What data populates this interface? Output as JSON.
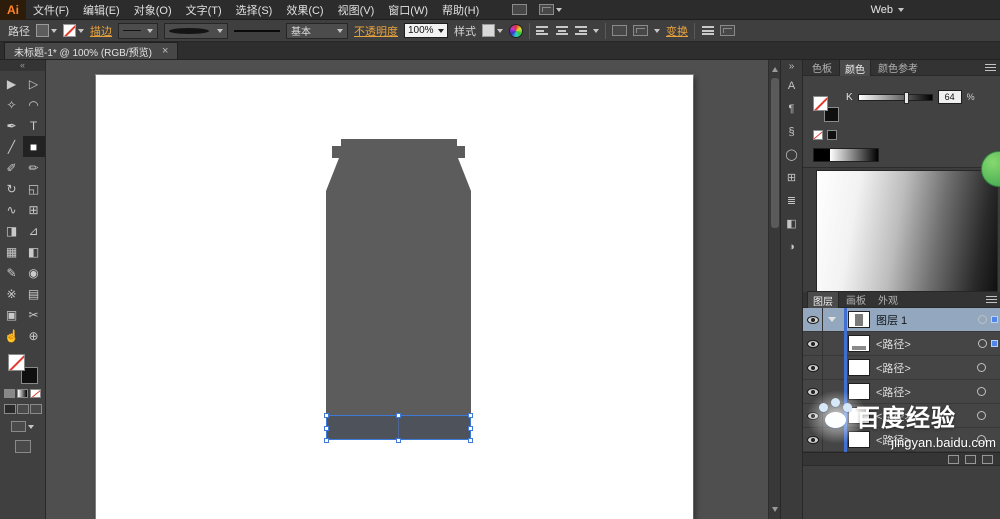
{
  "menu_bar": {
    "logo": "Ai",
    "items": [
      "文件(F)",
      "编辑(E)",
      "对象(O)",
      "文字(T)",
      "选择(S)",
      "效果(C)",
      "视图(V)",
      "窗口(W)",
      "帮助(H)"
    ],
    "workspace": "Web"
  },
  "control_bar": {
    "context_label": "路径",
    "stroke_link": "描边",
    "brush_name": "基本",
    "opacity_link": "不透明度",
    "opacity_value": "100%",
    "style_label": "样式",
    "transform_link": "变换"
  },
  "document_tab": {
    "title": "未标题-1* @ 100% (RGB/预览)",
    "close": "×"
  },
  "toolbar": {
    "collapse": "«",
    "tools": [
      {
        "name": "selection-tool",
        "glyph": "▶"
      },
      {
        "name": "direct-selection-tool",
        "glyph": "▷"
      },
      {
        "name": "magic-wand-tool",
        "glyph": "✧"
      },
      {
        "name": "lasso-tool",
        "glyph": "◠"
      },
      {
        "name": "pen-tool",
        "glyph": "✒"
      },
      {
        "name": "type-tool",
        "glyph": "T"
      },
      {
        "name": "line-segment-tool",
        "glyph": "╱"
      },
      {
        "name": "rectangle-tool",
        "glyph": "■"
      },
      {
        "name": "paintbrush-tool",
        "glyph": "✐"
      },
      {
        "name": "pencil-tool",
        "glyph": "✏"
      },
      {
        "name": "rotate-tool",
        "glyph": "↻"
      },
      {
        "name": "scale-tool",
        "glyph": "◱"
      },
      {
        "name": "width-tool",
        "glyph": "∿"
      },
      {
        "name": "free-transform-tool",
        "glyph": "⊞"
      },
      {
        "name": "shape-builder-tool",
        "glyph": "◨"
      },
      {
        "name": "perspective-grid-tool",
        "glyph": "⊿"
      },
      {
        "name": "mesh-tool",
        "glyph": "▦"
      },
      {
        "name": "gradient-tool",
        "glyph": "◧"
      },
      {
        "name": "eyedropper-tool",
        "glyph": "✎"
      },
      {
        "name": "blend-tool",
        "glyph": "◉"
      },
      {
        "name": "symbol-sprayer-tool",
        "glyph": "※"
      },
      {
        "name": "column-graph-tool",
        "glyph": "▤"
      },
      {
        "name": "artboard-tool",
        "glyph": "▣"
      },
      {
        "name": "slice-tool",
        "glyph": "✂"
      },
      {
        "name": "hand-tool",
        "glyph": "☝"
      },
      {
        "name": "zoom-tool",
        "glyph": "⊕"
      }
    ]
  },
  "dock": {
    "collapse": "»",
    "icons": [
      {
        "name": "character-panel-icon",
        "glyph": "A"
      },
      {
        "name": "paragraph-panel-icon",
        "glyph": "¶"
      },
      {
        "name": "glyphs-panel-icon",
        "glyph": "§"
      },
      {
        "name": "appearance-panel-icon",
        "glyph": "◯"
      },
      {
        "name": "transform-panel-icon",
        "glyph": "⊞"
      },
      {
        "name": "align-panel-icon",
        "glyph": "≣"
      },
      {
        "name": "pathfinder-panel-icon",
        "glyph": "◧"
      },
      {
        "name": "gradient-panel-icon",
        "glyph": "◑"
      }
    ]
  },
  "color_panel": {
    "tabs": [
      "色板",
      "颜色",
      "颜色参考"
    ],
    "channel": "K",
    "value": "64",
    "unit": "%"
  },
  "layers_panel": {
    "tabs": [
      "图层",
      "画板",
      "外观"
    ],
    "rows": [
      {
        "label": "图层 1"
      },
      {
        "label": "<路径>"
      },
      {
        "label": "<路径>"
      },
      {
        "label": "<路径>"
      },
      {
        "label": "<路径>"
      },
      {
        "label": "<路径>"
      }
    ]
  },
  "watermark": {
    "title": "百度经验",
    "url": "jingyan.baidu.com"
  }
}
